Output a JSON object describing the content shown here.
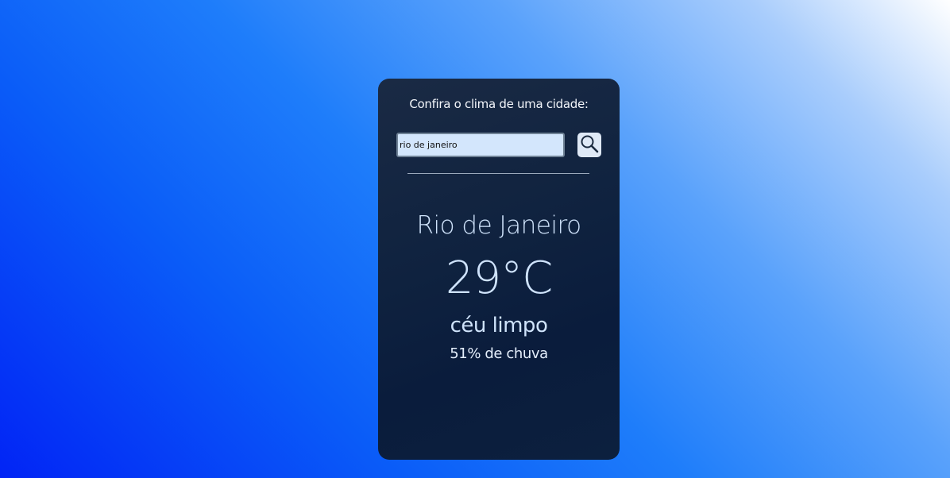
{
  "weather_widget": {
    "prompt": "Confira o clima de uma cidade:",
    "search": {
      "value": "rio de janeiro",
      "icon": "search-icon"
    },
    "city": "Rio de Janeiro",
    "temperature": "29°C",
    "description": "céu limpo",
    "rain_chance": "51% de chuva"
  },
  "colors": {
    "card_background": "#0f223f",
    "text_light_blue": "#cfe3fb",
    "input_background": "#d3e6fc",
    "button_background": "#dfe9f6",
    "gradient_start": "#ffffff",
    "gradient_end": "#0224f5"
  }
}
